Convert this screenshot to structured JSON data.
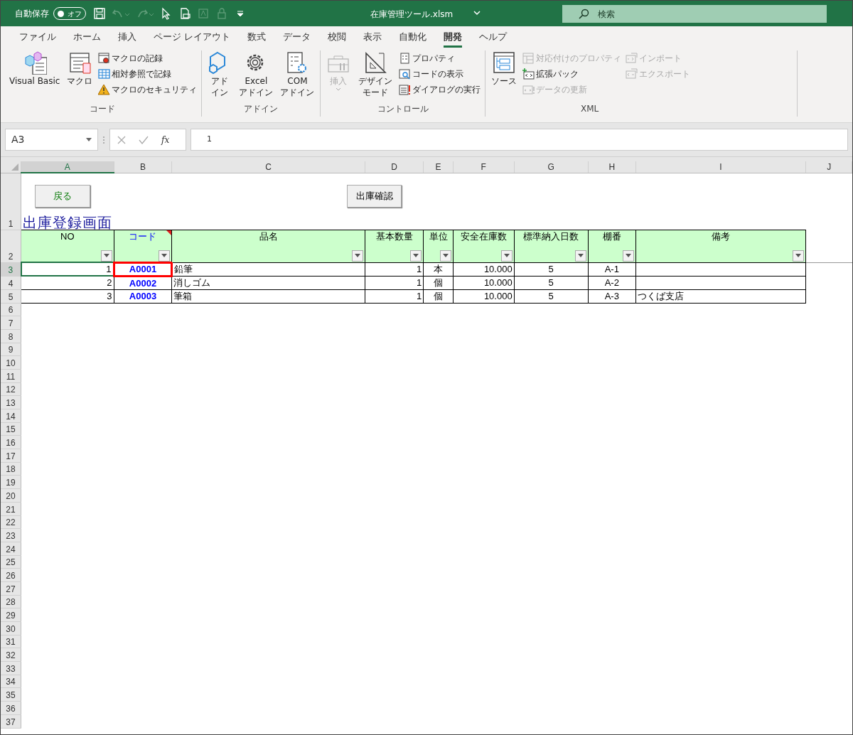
{
  "title_bar": {
    "autosave": {
      "label": "自動保存",
      "state_label": "オフ",
      "on": false
    },
    "quick_access": [
      {
        "kind": "save",
        "disabled": false
      },
      {
        "kind": "undo",
        "disabled": true
      },
      {
        "kind": "redo",
        "disabled": true
      },
      {
        "kind": "pointer",
        "disabled": false
      },
      {
        "kind": "preview",
        "disabled": false
      },
      {
        "kind": "textbox",
        "disabled": true
      },
      {
        "kind": "lock",
        "disabled": true
      },
      {
        "kind": "customize",
        "disabled": false
      }
    ],
    "file_name": "在庫管理ツール.xlsm",
    "search": {
      "placeholder": "検索"
    }
  },
  "ribbon_tabs": [
    {
      "label": "ファイル",
      "selected": false
    },
    {
      "label": "ホーム",
      "selected": false
    },
    {
      "label": "挿入",
      "selected": false
    },
    {
      "label": "ページ レイアウト",
      "selected": false
    },
    {
      "label": "数式",
      "selected": false
    },
    {
      "label": "データ",
      "selected": false
    },
    {
      "label": "校閲",
      "selected": false
    },
    {
      "label": "表示",
      "selected": false
    },
    {
      "label": "自動化",
      "selected": false
    },
    {
      "label": "開発",
      "selected": true
    },
    {
      "label": "ヘルプ",
      "selected": false
    }
  ],
  "ribbon_groups": [
    {
      "label": "コード",
      "columns": [
        [
          {
            "kind": "visual-basic",
            "label": "Visual Basic",
            "disabled": false
          }
        ],
        [
          {
            "kind": "macro",
            "label": "マクロ",
            "disabled": false
          }
        ],
        [
          {
            "kind": "record",
            "label": "マクロの記録",
            "disabled": false
          },
          {
            "kind": "relative",
            "label": "相対参照で記録",
            "disabled": false
          },
          {
            "kind": "warning",
            "label": "マクロのセキュリティ",
            "disabled": false
          }
        ]
      ]
    },
    {
      "label": "アドイン",
      "columns": [
        [
          {
            "kind": "addin",
            "label": "アドイン",
            "disabled": false
          }
        ],
        [
          {
            "kind": "gear",
            "label": "Excel\nアドイン",
            "disabled": false
          }
        ],
        [
          {
            "kind": "com",
            "label": "COM\nアドイン",
            "disabled": false
          }
        ]
      ]
    },
    {
      "label": "コントロール",
      "columns": [
        [
          {
            "kind": "toolbox",
            "label": "挿入",
            "disabled": true,
            "dropdown": true
          }
        ],
        [
          {
            "kind": "triangle",
            "label": "デザインモード",
            "disabled": false
          }
        ],
        [
          {
            "kind": "properties",
            "label": "プロパティ",
            "disabled": false
          },
          {
            "kind": "view-code",
            "label": "コードの表示",
            "disabled": false
          },
          {
            "kind": "dialog",
            "label": "ダイアログの実行",
            "disabled": false
          }
        ]
      ]
    },
    {
      "label": "XML",
      "columns": [
        [
          {
            "kind": "source",
            "label": "ソース",
            "disabled": false
          }
        ],
        [
          {
            "kind": "map",
            "label": "対応付けのプロパティ",
            "disabled": true
          },
          {
            "kind": "pack",
            "label": "拡張パック",
            "disabled": false
          },
          {
            "kind": "refresh",
            "label": "データの更新",
            "disabled": true
          }
        ],
        [
          {
            "kind": "import",
            "label": "インポート",
            "disabled": true
          },
          {
            "kind": "export",
            "label": "エクスポート",
            "disabled": true
          }
        ]
      ]
    }
  ],
  "formula_bar": {
    "name_box": "A3",
    "function_label": "fx",
    "formula": "1",
    "cancel_disabled": true,
    "enter_disabled": true
  },
  "sheet": {
    "column_headers": [
      {
        "label": "A",
        "selected": true
      },
      {
        "label": "B",
        "selected": false
      },
      {
        "label": "C",
        "selected": false
      },
      {
        "label": "D",
        "selected": false
      },
      {
        "label": "E",
        "selected": false
      },
      {
        "label": "F",
        "selected": false
      },
      {
        "label": "G",
        "selected": false
      },
      {
        "label": "H",
        "selected": false
      },
      {
        "label": "I",
        "selected": false
      },
      {
        "label": "J",
        "selected": false
      }
    ],
    "row_numbers": [
      {
        "label": "1",
        "selected": false
      },
      {
        "label": "2",
        "selected": false
      },
      {
        "label": "3",
        "selected": true
      },
      {
        "label": "4",
        "selected": false
      },
      {
        "label": "5",
        "selected": false
      },
      {
        "label": "6",
        "selected": false
      },
      {
        "label": "7",
        "selected": false
      },
      {
        "label": "8",
        "selected": false
      },
      {
        "label": "9",
        "selected": false
      },
      {
        "label": "10",
        "selected": false
      },
      {
        "label": "11",
        "selected": false
      },
      {
        "label": "12",
        "selected": false
      },
      {
        "label": "13",
        "selected": false
      },
      {
        "label": "14",
        "selected": false
      },
      {
        "label": "15",
        "selected": false
      },
      {
        "label": "16",
        "selected": false
      },
      {
        "label": "17",
        "selected": false
      },
      {
        "label": "18",
        "selected": false
      },
      {
        "label": "19",
        "selected": false
      },
      {
        "label": "20",
        "selected": false
      },
      {
        "label": "21",
        "selected": false
      },
      {
        "label": "22",
        "selected": false
      },
      {
        "label": "23",
        "selected": false
      },
      {
        "label": "24",
        "selected": false
      },
      {
        "label": "25",
        "selected": false
      },
      {
        "label": "26",
        "selected": false
      },
      {
        "label": "27",
        "selected": false
      },
      {
        "label": "28",
        "selected": false
      },
      {
        "label": "29",
        "selected": false
      },
      {
        "label": "30",
        "selected": false
      },
      {
        "label": "31",
        "selected": false
      },
      {
        "label": "32",
        "selected": false
      },
      {
        "label": "33",
        "selected": false
      },
      {
        "label": "34",
        "selected": false
      },
      {
        "label": "35",
        "selected": false
      },
      {
        "label": "36",
        "selected": false
      },
      {
        "label": "37",
        "selected": false
      }
    ],
    "buttons": [
      {
        "label": "戻る",
        "kind": "back"
      },
      {
        "label": "出庫確認",
        "kind": "confirm"
      }
    ],
    "title": "出庫登録画面",
    "table": {
      "columns": [
        {
          "label": "NO",
          "has_comment": false
        },
        {
          "label": "コード",
          "has_comment": true
        },
        {
          "label": "品名",
          "has_comment": false
        },
        {
          "label": "基本数量",
          "has_comment": false
        },
        {
          "label": "単位",
          "has_comment": false
        },
        {
          "label": "安全在庫数",
          "has_comment": false
        },
        {
          "label": "標準納入日数",
          "has_comment": false
        },
        {
          "label": "棚番",
          "has_comment": false
        },
        {
          "label": "備考",
          "has_comment": false
        }
      ],
      "rows": [
        {
          "selected": true,
          "code_flagged": true,
          "cells": [
            "1",
            "A0001",
            "鉛筆",
            "1",
            "本",
            "10.000",
            "5",
            "A-1",
            ""
          ]
        },
        {
          "selected": false,
          "code_flagged": false,
          "cells": [
            "2",
            "A0002",
            "消しゴム",
            "1",
            "個",
            "10.000",
            "5",
            "A-2",
            ""
          ]
        },
        {
          "selected": false,
          "code_flagged": false,
          "cells": [
            "3",
            "A0003",
            "筆箱",
            "1",
            "個",
            "10.000",
            "5",
            "A-3",
            "つくば支店"
          ]
        }
      ]
    }
  }
}
